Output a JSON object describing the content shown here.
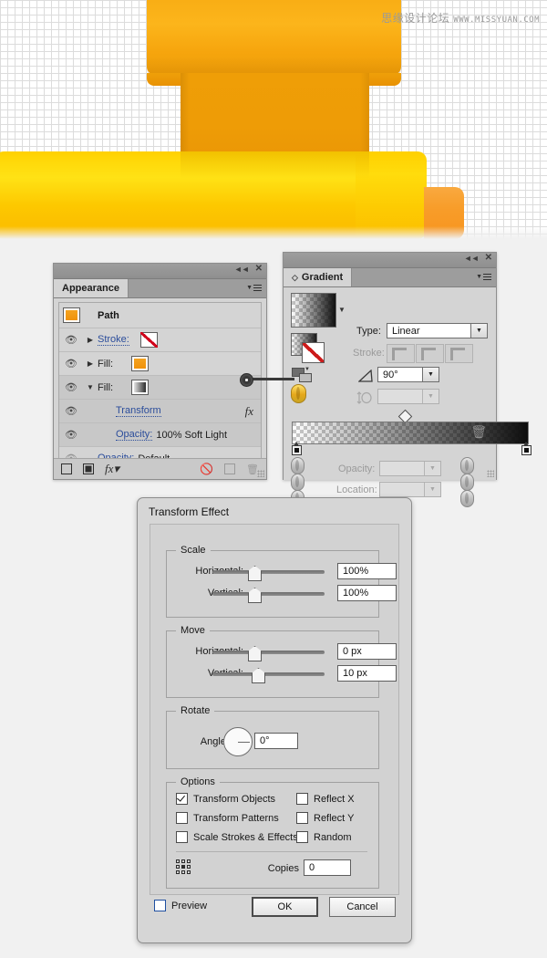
{
  "artwork": {
    "watermark_cn": "思缘设计论坛",
    "watermark_url": "WWW.MISSYUAN.COM"
  },
  "appearance_panel": {
    "tab_label": "Appearance",
    "collapse_icon": "◄◄",
    "close_icon": "✕",
    "rows": [
      {
        "name": "Path",
        "kind": "title"
      },
      {
        "label": "Stroke:",
        "swatch": "none",
        "kind": "attribute"
      },
      {
        "label": "Fill:",
        "swatch": "orange",
        "kind": "attribute"
      },
      {
        "label": "Fill:",
        "swatch": "gradient",
        "kind": "attribute",
        "expanded": true
      },
      {
        "label": "Transform",
        "kind": "effect",
        "fx": "fx"
      },
      {
        "label": "Opacity:",
        "value": "100% Soft Light",
        "kind": "opacity"
      },
      {
        "label": "Opacity:",
        "value": "Default",
        "kind": "opacity",
        "dim": true
      }
    ],
    "footer_icons": [
      "add-new-stroke-icon",
      "add-new-fill-icon",
      "add-new-effect-icon",
      "clear-appearance-icon",
      "duplicate-item-icon",
      "delete-item-icon"
    ]
  },
  "gradient_panel": {
    "tab_label": "Gradient",
    "collapse_icon": "◄◄",
    "close_icon": "✕",
    "type_label": "Type:",
    "type_value": "Linear",
    "stroke_label": "Stroke:",
    "angle_label": "angle-icon",
    "angle_value": "90°",
    "aspect_label": "aspect-ratio-icon",
    "aspect_value": "",
    "opacity_label": "Opacity:",
    "opacity_value": "",
    "location_label": "Location:",
    "location_value": "",
    "delete_stop_icon": "delete-stop-icon"
  },
  "transform_dialog": {
    "title": "Transform Effect",
    "scale": {
      "legend": "Scale",
      "horizontal_label": "Horizontal:",
      "horizontal_value": "100%",
      "vertical_label": "Vertical:",
      "vertical_value": "100%"
    },
    "move": {
      "legend": "Move",
      "horizontal_label": "Horizontal:",
      "horizontal_value": "0 px",
      "vertical_label": "Vertical:",
      "vertical_value": "10 px"
    },
    "rotate": {
      "legend": "Rotate",
      "angle_label": "Angle:",
      "angle_value": "0°"
    },
    "options": {
      "legend": "Options",
      "items": [
        {
          "label": "Transform Objects",
          "checked": true
        },
        {
          "label": "Reflect X",
          "checked": false
        },
        {
          "label": "Transform Patterns",
          "checked": false
        },
        {
          "label": "Reflect Y",
          "checked": false
        },
        {
          "label": "Scale Strokes & Effects",
          "checked": false
        },
        {
          "label": "Random",
          "checked": false
        }
      ],
      "copies_label": "Copies",
      "copies_value": "0"
    },
    "preview_label": "Preview",
    "preview_checked": false,
    "ok_label": "OK",
    "cancel_label": "Cancel"
  }
}
